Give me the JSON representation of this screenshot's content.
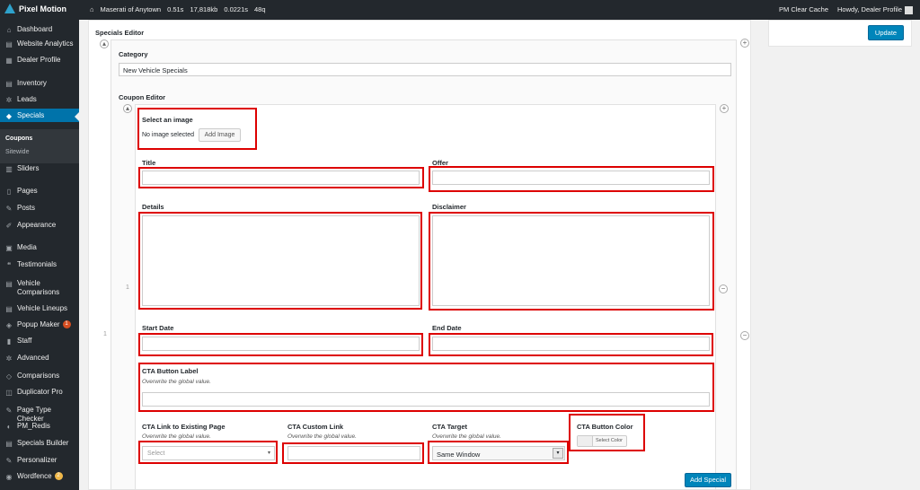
{
  "topbar": {
    "brand": "Pixel Motion",
    "site": "Maserati of Anytown",
    "stats": [
      "0.51s",
      "17,818kb",
      "0.0221s",
      "48q"
    ],
    "clear_cache": "PM Clear Cache",
    "greeting": "Howdy, Dealer Profile"
  },
  "sidebar": {
    "items": [
      {
        "label": "Dashboard",
        "icon": "dashboard-icon",
        "glyph": "⌂"
      },
      {
        "label": "Website Analytics",
        "icon": "analytics-icon",
        "glyph": "▤"
      },
      {
        "label": "Dealer Profile",
        "icon": "profile-icon",
        "glyph": "▦"
      },
      {
        "label": "Inventory",
        "icon": "inventory-icon",
        "glyph": "▤"
      },
      {
        "label": "Leads",
        "icon": "gear-icon",
        "glyph": "✲"
      },
      {
        "label": "Specials",
        "icon": "tag-icon",
        "glyph": "◆"
      },
      {
        "label": "Sliders",
        "icon": "sliders-icon",
        "glyph": "▥"
      },
      {
        "label": "Pages",
        "icon": "pages-icon",
        "glyph": "▯"
      },
      {
        "label": "Posts",
        "icon": "pin-icon",
        "glyph": "✎"
      },
      {
        "label": "Appearance",
        "icon": "brush-icon",
        "glyph": "✐"
      },
      {
        "label": "Media",
        "icon": "media-icon",
        "glyph": "▣"
      },
      {
        "label": "Testimonials",
        "icon": "quote-icon",
        "glyph": "❝"
      },
      {
        "label": "Vehicle Comparisons",
        "icon": "compare-icon",
        "glyph": "▤"
      },
      {
        "label": "Vehicle Lineups",
        "icon": "lineups-icon",
        "glyph": "▤"
      },
      {
        "label": "Popup Maker",
        "icon": "popup-icon",
        "glyph": "◈",
        "badge": "1"
      },
      {
        "label": "Staff",
        "icon": "staff-icon",
        "glyph": "▮"
      },
      {
        "label": "Advanced",
        "icon": "settings-icon",
        "glyph": "✲"
      },
      {
        "label": "Comparisons",
        "icon": "code-icon",
        "glyph": "◇"
      },
      {
        "label": "Duplicator Pro",
        "icon": "duplicate-icon",
        "glyph": "◫"
      },
      {
        "label": "Page Type Checker",
        "icon": "tools-icon",
        "glyph": "✎"
      },
      {
        "label": "PM_Redis",
        "icon": "redis-icon",
        "glyph": "◐"
      },
      {
        "label": "Specials Builder",
        "icon": "builder-icon",
        "glyph": "▤"
      },
      {
        "label": "Personalizer",
        "icon": "pin-icon",
        "glyph": "✎"
      },
      {
        "label": "Wordfence",
        "icon": "wordfence-icon",
        "glyph": "◉",
        "badge": "2"
      }
    ],
    "submenu": [
      "Coupons",
      "Sitewide"
    ]
  },
  "editor": {
    "heading": "Specials Editor",
    "category_label": "Category",
    "category_value": "New Vehicle Specials",
    "coupon_label": "Coupon Editor",
    "image_label": "Select an image",
    "no_image": "No image selected",
    "add_image": "Add Image",
    "title_label": "Title",
    "offer_label": "Offer",
    "details_label": "Details",
    "disclaimer_label": "Disclaimer",
    "start_label": "Start Date",
    "end_label": "End Date",
    "cta_label": "CTA Button Label",
    "overwrite": "Overwrite the global value.",
    "cta_link_label": "CTA Link to Existing Page",
    "cta_link_placeholder": "Select",
    "cta_custom_label": "CTA Custom Link",
    "cta_target_label": "CTA Target",
    "cta_target_value": "Same Window",
    "cta_color_label": "CTA Button Color",
    "select_color": "Select Color",
    "add_special": "Add Special",
    "row_number_inner": "1",
    "row_number_outer": "1",
    "plus": "+",
    "minus": "−"
  },
  "side": {
    "update": "Update"
  }
}
